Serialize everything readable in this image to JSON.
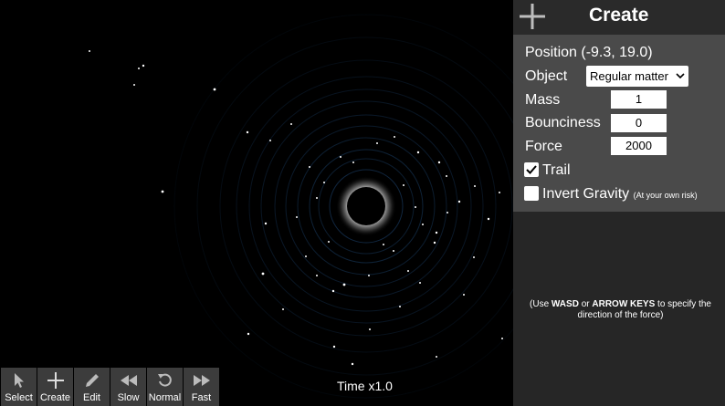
{
  "toolbar": {
    "items": [
      {
        "label": "Select",
        "icon": "cursor-icon"
      },
      {
        "label": "Create",
        "icon": "plus-icon"
      },
      {
        "label": "Edit",
        "icon": "pencil-icon"
      },
      {
        "label": "Slow",
        "icon": "rewind-icon"
      },
      {
        "label": "Normal",
        "icon": "reset-icon"
      },
      {
        "label": "Fast",
        "icon": "fast-forward-icon"
      }
    ]
  },
  "time_label": "Time x1.0",
  "panel": {
    "title": "Create",
    "position": "Position (-9.3, 19.0)",
    "object_label": "Object",
    "object_value": "Regular matter",
    "mass_label": "Mass",
    "mass_value": "1",
    "bounciness_label": "Bounciness",
    "bounciness_value": "0",
    "force_label": "Force",
    "force_value": "2000",
    "trail_label": "Trail",
    "trail_checked": true,
    "invert_label": "Invert Gravity",
    "invert_note": "(At your own risk)",
    "invert_checked": false,
    "hint_pre": "(Use ",
    "hint_key1": "WASD",
    "hint_mid": " or ",
    "hint_key2": "ARROW KEYS",
    "hint_post": " to specify the direction of the force)"
  },
  "colors": {
    "panel_bg": "#262626",
    "panel_body": "#4a4a4a",
    "toolbar_btn": "#3c3c3c",
    "orbit": "#16304e"
  }
}
